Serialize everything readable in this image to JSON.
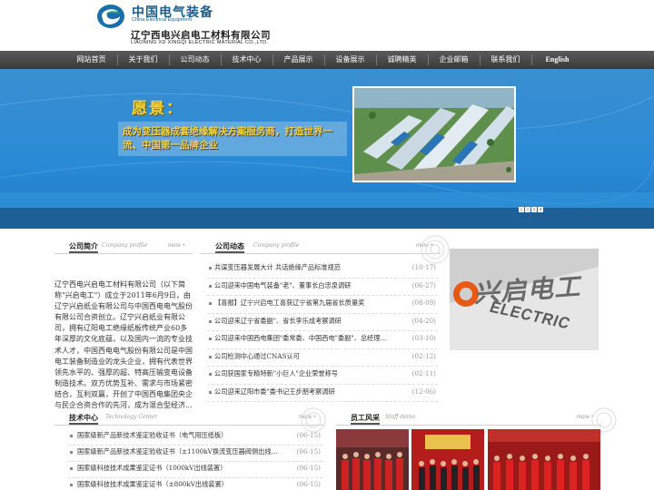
{
  "header": {
    "brand_cn": "中国电气装备",
    "brand_en": "China Electrical Equipment",
    "company_cn": "辽宁西电兴启电工材料有限公司",
    "company_en": "LIAONING XD XINGQI ELECTRIC MATERIAL CO.,LTD."
  },
  "nav": {
    "items": [
      "网站首页",
      "关于我们",
      "公司动态",
      "技术中心",
      "产品展示",
      "设备展示",
      "诚聘精英",
      "企业邮箱",
      "联系我们",
      "English"
    ]
  },
  "banner": {
    "vision": "愿景：",
    "slogan": "成为变压器成套绝缘解决方案服务商，打造世界一流、中国第一品牌企业",
    "dots": [
      "1",
      "2",
      "3",
      "4"
    ]
  },
  "about": {
    "title": "公司简介",
    "subtitle": "Company profile",
    "more": "more +",
    "text": "辽宁西电兴启电工材料有限公司（以下简称\"兴启电工\"）成立于2011年6月9日，由辽宁兴启纸业有限公司与中国西电电气股份有限公司合资创立。辽宁兴启纸业有限公司，拥有辽阳电工绝缘纸板传统产业60多年深厚的文化底蕴，以及国内一流的专业技术人才，中国西电电气股份有限公司是中国电工装备制造业的龙头企业，拥有代表世界领先水平的、强厚的超、特高压输变电设备制造技术。双方优势互补、需求与市场紧密结合，互利双赢，开创了中国西电集团央企与民企合资合作的先河，成为混合型经济..."
  },
  "news": {
    "title": "公司动态",
    "subtitle": "Company profile",
    "more": "more +",
    "items": [
      {
        "text": "共谋变压器发展大计 共话绝缘产品标准规范",
        "date": "(10-17)"
      },
      {
        "text": "公司迎来中国电气装备\"老\"、董事长白忠泉调研",
        "date": "(06-27)"
      },
      {
        "text": "【喜报】辽宁兴启电工喜获辽宁省第九届省长质量奖",
        "date": "(08-09)"
      },
      {
        "text": "公司迎来辽宁省委副\"、省长李乐成考察调研",
        "date": "(04-20)"
      },
      {
        "text": "公司迎来中国西电集团\"委常委、中国西电\"委副\"、总经理...",
        "date": "(03-10)"
      },
      {
        "text": "公司检测中心通过CNAS认可",
        "date": "(02-12)"
      },
      {
        "text": "公司获国家专精特新\"小巨人\"企业荣誉称号",
        "date": "(02-11)"
      },
      {
        "text": "公司迎来辽阳市委\"委书记王步朋考察调研",
        "date": "(12-06)"
      }
    ]
  },
  "side_photo": {
    "sign_text": "兴启电工",
    "sign_en": "ELECTRIC"
  },
  "tech": {
    "title": "技术中心",
    "subtitle": "Technology Center",
    "more": "more +",
    "items": [
      {
        "text": "国家级新产品新技术鉴定验收证书（电气用压纸板）",
        "date": "(06-15)"
      },
      {
        "text": "国家级新产品新技术鉴定验收证书（±1100kV换流变压器阀侧出线...",
        "date": "(06-15)"
      },
      {
        "text": "国家级科技技术成果鉴定证书（1000kV出线装置）",
        "date": "(06-15)"
      },
      {
        "text": "国家级科技技术成果鉴定证书（±800kV出线装置）",
        "date": "(06-15)"
      }
    ]
  },
  "staff": {
    "title": "员工风采",
    "subtitle": "Staff demo",
    "more": "more +"
  },
  "colors": {
    "nav_bg": "#4a4a4a",
    "banner_blue": "#2a8ad6",
    "slogan_yellow": "#f6d33a",
    "brand_blue": "#1a5f8c"
  }
}
